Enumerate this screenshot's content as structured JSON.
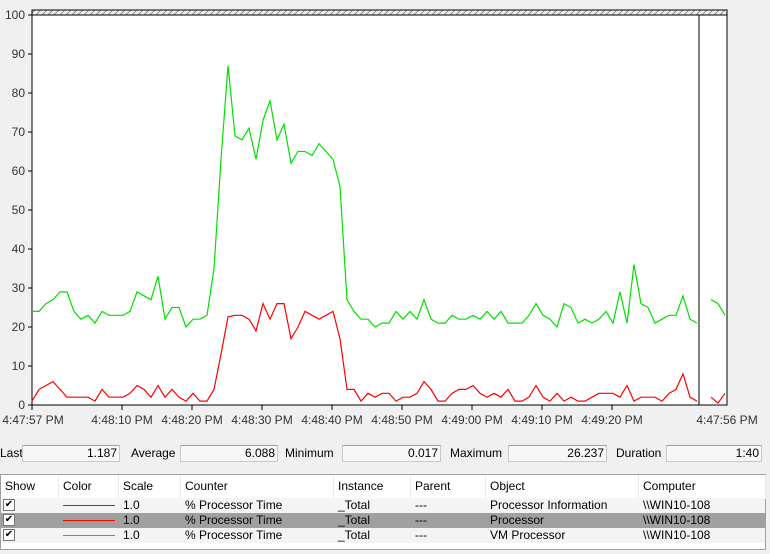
{
  "chart_data": {
    "type": "line",
    "title": "",
    "ylim": [
      0,
      100
    ],
    "y_ticks": [
      "0",
      "10",
      "20",
      "30",
      "40",
      "50",
      "60",
      "70",
      "80",
      "90",
      "100"
    ],
    "x_tick_labels": [
      "4:47:57 PM",
      "4:48:10 PM",
      "4:48:20 PM",
      "4:48:30 PM",
      "4:48:40 PM",
      "4:48:50 PM",
      "4:49:00 PM",
      "4:49:10 PM",
      "4:49:20 PM",
      "4:47:56 PM"
    ],
    "sample_interval_s": 1,
    "series": [
      {
        "name": "Processor Information % Processor Time",
        "color": "#00e000",
        "values": [
          24,
          24,
          26,
          27,
          29,
          29,
          24,
          22,
          23,
          21,
          24,
          23,
          23,
          23,
          24,
          29,
          28,
          27,
          33,
          22,
          25,
          25,
          20,
          22,
          22,
          23,
          35,
          63,
          87,
          69,
          68,
          71,
          63,
          73,
          78,
          68,
          72,
          62,
          65,
          65,
          64,
          67,
          65,
          63,
          56,
          27,
          24,
          22,
          22,
          20,
          21,
          21,
          24,
          22,
          24,
          22,
          27,
          22,
          21,
          21,
          23,
          22,
          22,
          23,
          22,
          24,
          22,
          24,
          21,
          21,
          21,
          23,
          26,
          23,
          22,
          20,
          26,
          25,
          21,
          22,
          21,
          22,
          24,
          21,
          29,
          21,
          36,
          26,
          25,
          21,
          22,
          23,
          23,
          28,
          22,
          21,
          null,
          27,
          26,
          23
        ]
      },
      {
        "name": "Processor % Processor Time",
        "color": "#ff0000",
        "values": [
          1,
          4,
          5,
          6,
          4,
          2,
          2,
          2,
          2,
          1,
          4,
          2,
          2,
          2,
          3,
          5,
          4,
          2,
          5,
          2,
          4,
          2,
          1,
          3,
          1,
          1,
          4,
          13,
          22.6,
          23,
          23,
          22,
          19,
          26,
          22,
          26,
          26,
          17,
          20,
          24,
          23,
          22,
          23,
          24,
          17,
          4,
          4,
          1,
          3,
          2,
          3,
          3,
          1,
          2,
          2,
          3,
          6,
          4,
          1,
          1,
          3,
          4,
          4,
          5,
          3,
          2,
          3,
          2,
          4,
          1,
          1,
          2,
          5,
          2,
          1,
          3,
          1,
          2,
          1,
          1,
          2,
          3,
          3,
          3,
          2,
          5,
          1,
          2,
          2,
          2,
          1,
          3,
          4,
          8,
          2,
          1,
          null,
          2,
          0.5,
          3
        ]
      }
    ]
  },
  "stats": {
    "last_label": "Last",
    "last": "1.187",
    "average_label": "Average",
    "average": "6.088",
    "minimum_label": "Minimum",
    "minimum": "0.017",
    "maximum_label": "Maximum",
    "maximum": "26.237",
    "duration_label": "Duration",
    "duration": "1:40"
  },
  "table": {
    "headers": [
      "Show",
      "Color",
      "Scale",
      "Counter",
      "Instance",
      "Parent",
      "Object",
      "Computer"
    ],
    "rows": [
      {
        "show": true,
        "color": "#ff0000",
        "scale": "1.0",
        "counter": "% Processor Time",
        "instance": "_Total",
        "parent": "---",
        "object": "Processor Information",
        "computer": "\\\\WIN10-108"
      },
      {
        "show": true,
        "color": "#ff0000",
        "scale": "1.0",
        "counter": "% Processor Time",
        "instance": "_Total",
        "parent": "---",
        "object": "Processor",
        "computer": "\\\\WIN10-108"
      },
      {
        "show": true,
        "color": "#00e000",
        "scale": "1.0",
        "counter": "% Processor Time",
        "instance": "_Total",
        "parent": "---",
        "object": "VM Processor",
        "computer": "\\\\WIN10-108"
      }
    ]
  }
}
